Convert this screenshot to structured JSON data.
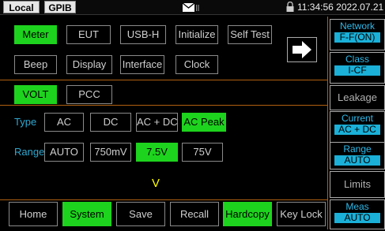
{
  "topbar": {
    "local_tag": "Local",
    "gpib_tag": "GPIB",
    "datetime": "11:34:56 2022.07.21"
  },
  "menu": {
    "row1": [
      "Meter",
      "EUT",
      "USB-H",
      "Initialize",
      "Self Test"
    ],
    "row2": [
      "Beep",
      "Display",
      "Interface",
      "Clock"
    ],
    "active": "Meter"
  },
  "mode": {
    "items": [
      "VOLT",
      "PCC"
    ],
    "active": "VOLT"
  },
  "type": {
    "label": "Type",
    "options": [
      "AC",
      "DC",
      "AC + DC",
      "AC Peak"
    ],
    "active": "AC Peak"
  },
  "range": {
    "label": "Range",
    "options": [
      "AUTO",
      "750mV",
      "7.5V",
      "75V"
    ],
    "active": "7.5V"
  },
  "unit_display": "V",
  "side": {
    "network": {
      "title": "Network",
      "value": "F-F(ON)"
    },
    "class": {
      "title": "Class",
      "value": "I-CF"
    },
    "leakage": "Leakage",
    "current": {
      "title": "Current",
      "value": "AC + DC"
    },
    "range": {
      "title": "Range",
      "value": "AUTO"
    },
    "limits": "Limits",
    "meas": {
      "title": "Meas",
      "value": "AUTO"
    }
  },
  "bottom": {
    "items": [
      "Home",
      "System",
      "Save",
      "Recall",
      "Hardcopy",
      "Key Lock"
    ],
    "active": [
      "System",
      "Hardcopy"
    ]
  },
  "colors": {
    "active_green": "#1ed31e",
    "accent_cyan": "#2fa8d0",
    "divider_orange": "#b06010",
    "unit_yellow": "#ffff00"
  },
  "icons": [
    "mail-icon",
    "lock-icon",
    "arrow-right-icon"
  ]
}
